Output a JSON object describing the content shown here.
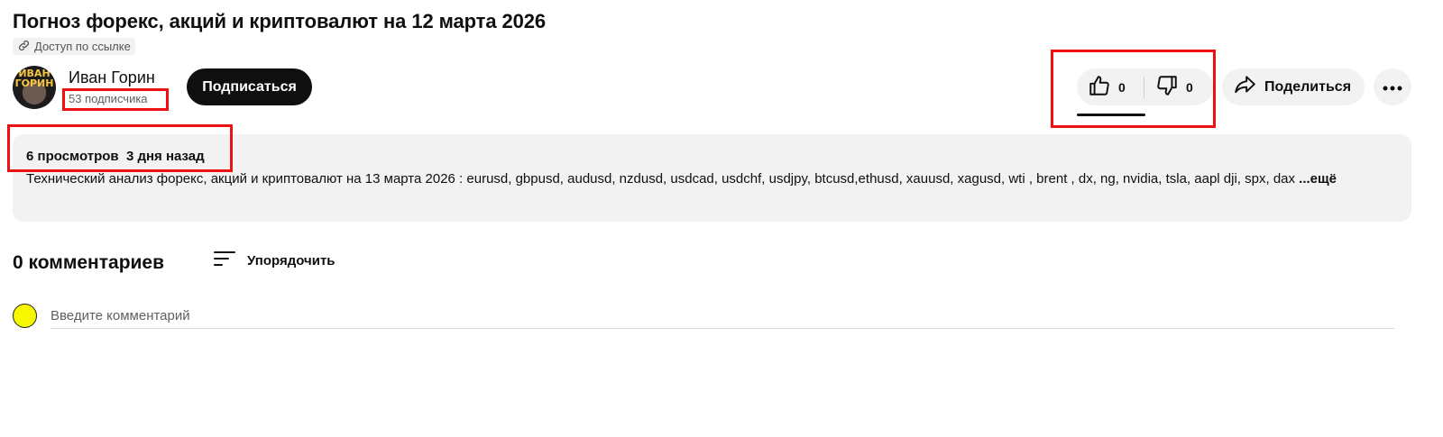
{
  "video": {
    "title": "Погноз форекс, акций и криптовалют на 12 марта 2026",
    "access_label": "Доступ по ссылке"
  },
  "channel": {
    "avatar_text": "ИВАН ГОРИН",
    "name": "Иван Горин",
    "subscribers": "53 подписчика",
    "subscribe_label": "Подписаться"
  },
  "actions": {
    "likes": "0",
    "dislikes": "0",
    "share_label": "Поделиться"
  },
  "description": {
    "meta": "6 просмотров  3 дня назад",
    "text": "Технический анализ форекс, акций и криптовалют на 13 марта  2026 : eurusd, gbpusd, audusd, nzdusd, usdcad, usdchf, usdjpy, btcusd,ethusd, xauusd, xagusd, wti , brent , dx, ng,  nvidia, tsla, aapl dji, spx, dax",
    "more_label": "...ещё"
  },
  "comments": {
    "count_label": "0 комментариев",
    "sort_label": "Упорядочить",
    "input_placeholder": "Введите комментарий"
  },
  "colors": {
    "highlight": "#ee1111",
    "subscribe_bg": "#0f0f0f",
    "pill_bg": "#f2f2f2",
    "comment_avatar": "#f7f700"
  },
  "icons": {
    "access": "link-icon",
    "like": "thumbs-up-icon",
    "dislike": "thumbs-down-icon",
    "share": "share-arrow-icon",
    "more": "more-dots-icon",
    "sort": "sort-lines-icon"
  }
}
